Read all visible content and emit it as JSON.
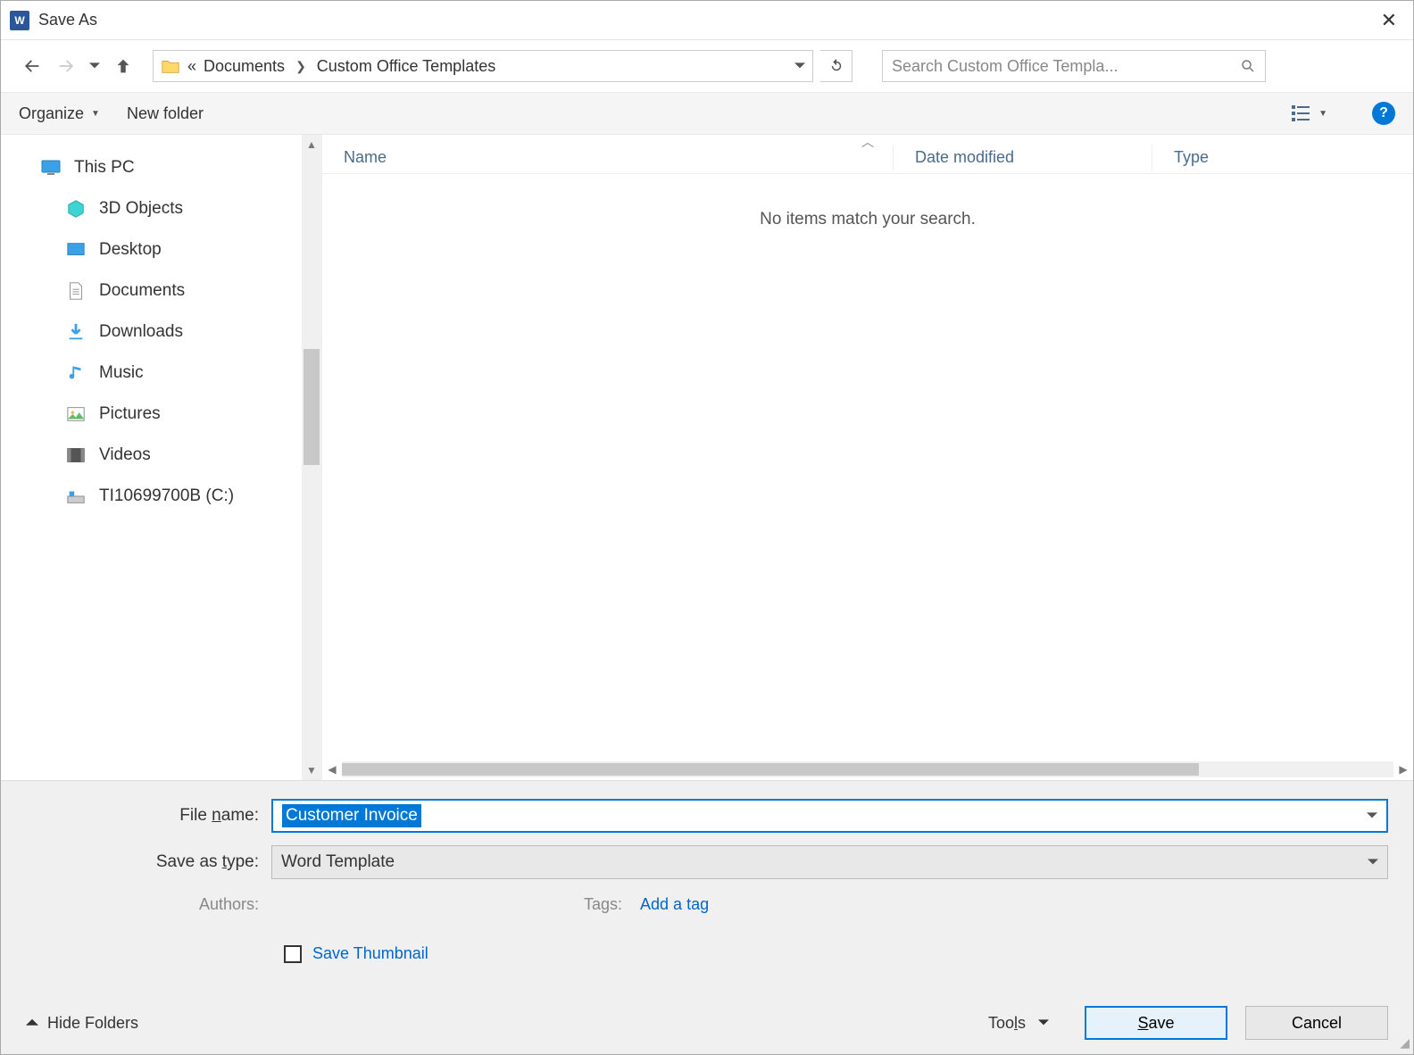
{
  "window": {
    "title": "Save As"
  },
  "nav": {
    "crumbs": [
      "Documents",
      "Custom Office Templates"
    ],
    "prefix": "«"
  },
  "search": {
    "placeholder": "Search Custom Office Templa..."
  },
  "toolbar": {
    "organize": "Organize",
    "new_folder": "New folder"
  },
  "sidebar": {
    "root": "This PC",
    "items": [
      "3D Objects",
      "Desktop",
      "Documents",
      "Downloads",
      "Music",
      "Pictures",
      "Videos",
      "TI10699700B (C:)"
    ]
  },
  "columns": {
    "name": "Name",
    "date": "Date modified",
    "type": "Type"
  },
  "list": {
    "empty": "No items match your search."
  },
  "form": {
    "filename_label_pre": "File ",
    "filename_label_ul": "n",
    "filename_label_post": "ame:",
    "filename_value": "Customer Invoice",
    "type_label_pre": "Save as ",
    "type_label_ul": "t",
    "type_label_post": "ype:",
    "type_value": "Word Template",
    "authors_label": "Authors:",
    "tags_label": "Tags:",
    "add_tag": "Add a tag",
    "save_thumbnail": "Save Thumbnail"
  },
  "footer": {
    "hide_folders": "Hide Folders",
    "tools_pre": "Too",
    "tools_ul": "l",
    "tools_post": "s",
    "save_ul": "S",
    "save_post": "ave",
    "cancel": "Cancel"
  }
}
